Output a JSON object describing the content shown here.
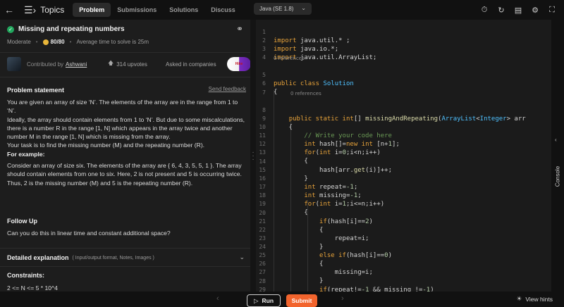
{
  "header": {
    "topics_label": "Topics",
    "tabs": [
      {
        "label": "Problem",
        "active": true
      },
      {
        "label": "Submissions",
        "active": false
      },
      {
        "label": "Solutions",
        "active": false
      },
      {
        "label": "Discuss",
        "active": false
      }
    ],
    "language": "Java (SE 1.8)",
    "icons": [
      "timer-icon",
      "refresh-icon",
      "notes-icon",
      "settings-icon",
      "fullscreen-icon"
    ]
  },
  "problem": {
    "title": "Missing and repeating numbers",
    "difficulty": "Moderate",
    "points": "80/80",
    "avg_time": "Average time to solve is 25m",
    "contributed_by": "Contributed by",
    "contributor": "Ashwani",
    "upvotes": "314 upvotes",
    "asked_in": "Asked in companies",
    "company_badge": "Hike",
    "statement_heading": "Problem statement",
    "send_feedback": "Send feedback",
    "statement_paragraphs": [
      "You are given an array of size ‘N’. The elements of the array are in the range from 1 to ‘N’.",
      "Ideally, the array should contain elements from 1 to ‘N’. But due to some miscalculations, there is a number R in the range [1, N] which appears in the array twice and another number M in the range [1, N] which is missing from the array.",
      "Your task is to find the missing number (M) and the repeating number (R)."
    ],
    "example_heading": "For example:",
    "example_text": "Consider an array of size six. The elements of the array are { 6, 4, 3, 5, 5, 1 }. The array should contain elements from one to six. Here, 2 is not present and 5 is occurring twice. Thus, 2 is the missing number (M) and 5 is the repeating number (R).",
    "follow_up_heading": "Follow Up",
    "follow_up_text": "Can you do this in linear time and constant additional space?",
    "detailed_heading": "Detailed explanation",
    "detailed_sub": "( Input/output format, Notes, Images )",
    "constraints_heading": "Constraints:",
    "constraints": [
      "2 <= N <= 5 * 10^4"
    ]
  },
  "editor": {
    "references_1": "0 references",
    "references_2": "0 references",
    "code_lines": [
      {
        "n": "1",
        "text": "import java.util.* ;"
      },
      {
        "n": "2",
        "text": "import java.io.*;"
      },
      {
        "n": "3",
        "text": "import java.util.ArrayList;"
      },
      {
        "n": "4",
        "text": ""
      },
      {
        "n": "5",
        "text": "public class Solution"
      },
      {
        "n": "6",
        "text": "{"
      },
      {
        "n": "7",
        "text": ""
      },
      {
        "n": "8",
        "text": "    public static int[] missingAndRepeating(ArrayList<Integer> arr"
      },
      {
        "n": "9",
        "text": "    {"
      },
      {
        "n": "10",
        "text": "        // Write your code here"
      },
      {
        "n": "11",
        "text": "        int hash[]=new int [n+1];"
      },
      {
        "n": "12",
        "text": "        for(int i=0;i<n;i++)"
      },
      {
        "n": "13",
        "text": "        {"
      },
      {
        "n": "14",
        "text": "            hash[arr.get(i)]++;"
      },
      {
        "n": "15",
        "text": "        }"
      },
      {
        "n": "16",
        "text": "        int repeat=-1;"
      },
      {
        "n": "17",
        "text": "        int missing=-1;"
      },
      {
        "n": "18",
        "text": "        for(int i=1;i<=n;i++)"
      },
      {
        "n": "19",
        "text": "        {"
      },
      {
        "n": "20",
        "text": "            if(hash[i]==2)"
      },
      {
        "n": "21",
        "text": "            {"
      },
      {
        "n": "22",
        "text": "                repeat=i;"
      },
      {
        "n": "23",
        "text": "            }"
      },
      {
        "n": "24",
        "text": "            else if(hash[i]==0)"
      },
      {
        "n": "25",
        "text": "            {"
      },
      {
        "n": "26",
        "text": "                missing=i;"
      },
      {
        "n": "27",
        "text": "            }"
      },
      {
        "n": "28",
        "text": "            if(repeat!=-1 && missing !=-1)"
      },
      {
        "n": "29",
        "text": "            {"
      }
    ]
  },
  "console": {
    "label": "Console"
  },
  "footer": {
    "run_label": "Run",
    "submit_label": "Submit",
    "hints_label": "View hints"
  },
  "colors": {
    "accent": "#f2642d",
    "success": "#22a85e",
    "keyword": "#e8a33a",
    "type": "#4fc1ff"
  }
}
